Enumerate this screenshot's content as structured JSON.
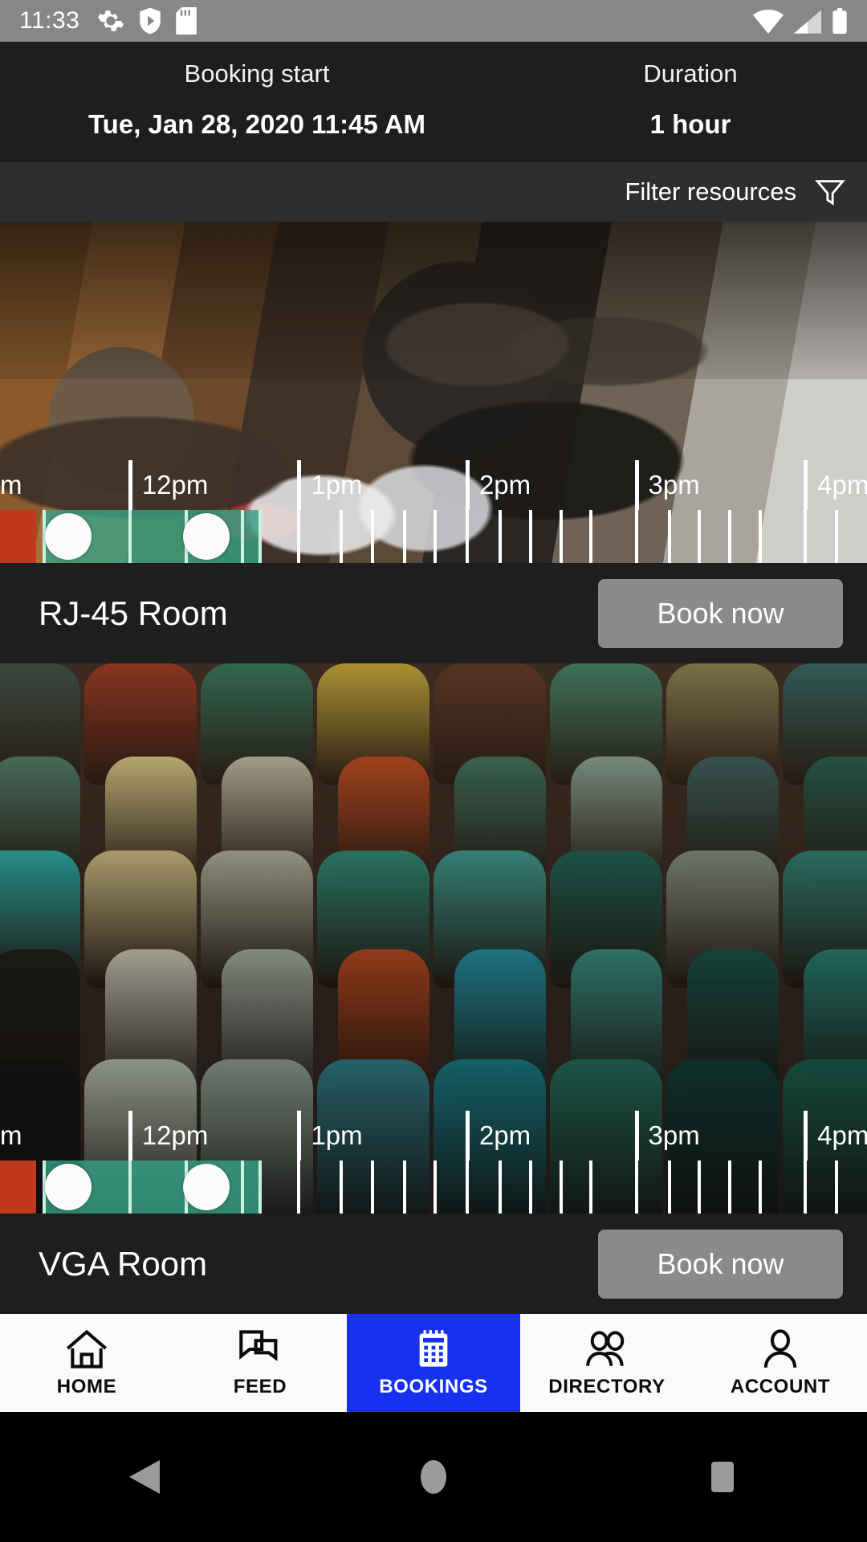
{
  "status_bar": {
    "clock": "11:33",
    "left_icons": [
      "gear-icon",
      "shield-play-icon",
      "sd-card-icon"
    ],
    "right_icons": [
      "wifi-icon",
      "signal-icon",
      "battery-icon"
    ]
  },
  "booking_header": {
    "start_label": "Booking start",
    "start_value": "Tue, Jan 28, 2020 11:45 AM",
    "duration_label": "Duration",
    "duration_value": "1 hour"
  },
  "filter": {
    "label": "Filter resources",
    "icon": "funnel-icon"
  },
  "timeline": {
    "ticks": [
      {
        "label": "m",
        "left_pct": 0.0,
        "line": false
      },
      {
        "label": "12pm",
        "left_pct": 14.8,
        "line": true
      },
      {
        "label": "1pm",
        "left_pct": 34.3,
        "line": true
      },
      {
        "label": "2pm",
        "left_pct": 53.7,
        "line": true
      },
      {
        "label": "3pm",
        "left_pct": 73.2,
        "line": true
      },
      {
        "label": "4pm",
        "left_pct": 92.7,
        "line": true
      }
    ],
    "busy_segment": {
      "left_pct": 0.0,
      "width_pct": 4.2
    },
    "selected_segment": {
      "left_pct": 4.9,
      "width_pct": 24.9
    },
    "selected_dividers_pct": [
      4.9,
      14.8,
      21.3,
      27.8,
      29.8
    ],
    "handles_pct": [
      7.9,
      23.8
    ],
    "dividers_pct": [
      34.3,
      39.2,
      42.8,
      46.5,
      50.0,
      53.7,
      57.5,
      61.0,
      64.5,
      68.0,
      73.2,
      77.0,
      80.5,
      84.0,
      87.5,
      92.7,
      96.3
    ]
  },
  "resources": [
    {
      "name": "RJ-45 Room",
      "book_label": "Book now",
      "photo": "meeting-room-photo"
    },
    {
      "name": "VGA Room",
      "book_label": "Book now",
      "photo": "colored-chairs-photo"
    }
  ],
  "bottom_nav": {
    "active_index": 2,
    "items": [
      {
        "label": "HOME",
        "icon": "home-icon"
      },
      {
        "label": "FEED",
        "icon": "chat-bubbles-icon"
      },
      {
        "label": "BOOKINGS",
        "icon": "calendar-icon"
      },
      {
        "label": "DIRECTORY",
        "icon": "people-icon"
      },
      {
        "label": "ACCOUNT",
        "icon": "person-icon"
      }
    ]
  },
  "system_nav": {
    "items": [
      {
        "icon": "back-triangle-icon"
      },
      {
        "icon": "home-circle-icon"
      },
      {
        "icon": "recents-square-icon"
      }
    ]
  },
  "colors": {
    "accent": "#1831f0",
    "busy": "#c0391c",
    "available": "#37a082",
    "panel": "#1e1e1e",
    "filter_bar": "#2e2e2e",
    "status_bar": "#878787",
    "button": "#8a8a8a"
  }
}
